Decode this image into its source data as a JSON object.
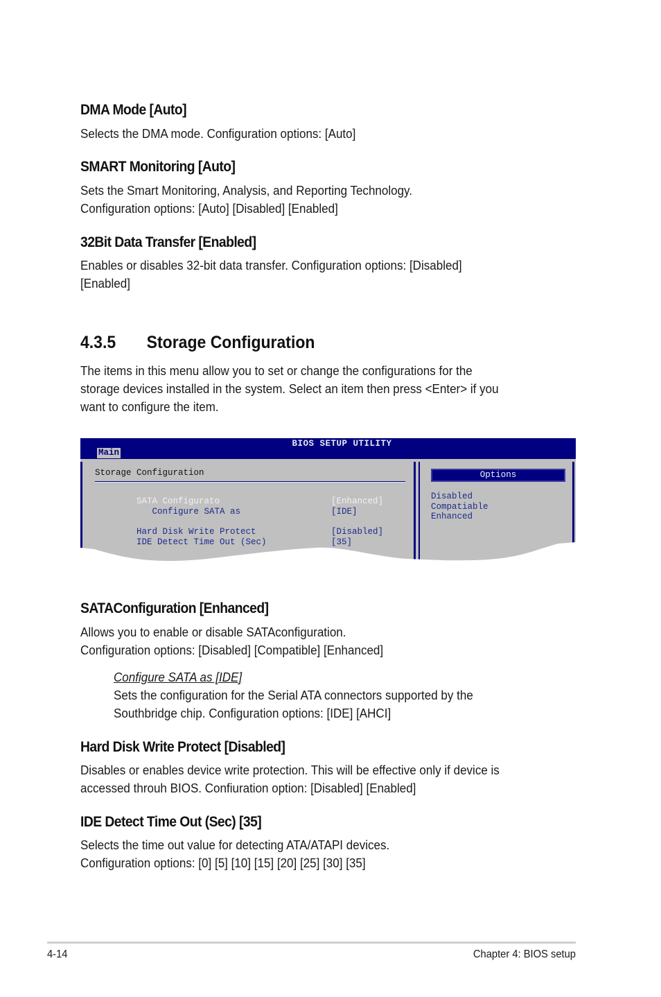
{
  "sections": [
    {
      "heading": "DMA Mode [Auto]",
      "lines": [
        "Selects the DMA mode. Configuration options: [Auto]"
      ]
    },
    {
      "heading": "SMART Monitoring [Auto]",
      "lines": [
        "Sets the Smart Monitoring, Analysis, and Reporting Technology.",
        "Configuration options: [Auto] [Disabled] [Enabled]"
      ]
    },
    {
      "heading": "32Bit Data Transfer [Enabled]",
      "lines": [
        "Enables or disables 32-bit data transfer. Configuration options: [Disabled]",
        "[Enabled]"
      ]
    }
  ],
  "chapter_section": {
    "number": "4.3.5",
    "title": "Storage Configuration",
    "intro_lines": [
      "The items in this menu allow you to set or change the configurations for the",
      "storage devices installed in the system. Select an item then press <Enter> if you",
      "want to configure the item."
    ]
  },
  "bios": {
    "title": "BIOS SETUP UTILITY",
    "active_tab": "Main",
    "section_title": "Storage Configuration",
    "items": [
      {
        "label": "SATA Configurato",
        "value": "[Enhanced]",
        "highlighted": true
      },
      {
        "label": "   Configure SATA as",
        "value": "[IDE]",
        "highlighted": false
      },
      {
        "label": "Hard Disk Write Protect",
        "value": "[Disabled]",
        "highlighted": false
      },
      {
        "label": "IDE Detect Time Out (Sec)",
        "value": "[35]",
        "highlighted": false
      }
    ],
    "options_header": "Options",
    "options": [
      "Disabled",
      "Compatiable",
      "Enhanced"
    ],
    "colors": {
      "header_bg": "#000080",
      "panel_bg": "#c0c0c0",
      "item_text": "#1d2a8c",
      "highlight_text": "#f2f2f2"
    }
  },
  "sections_after": [
    {
      "heading": "SATAConfiguration [Enhanced]",
      "lines": [
        "Allows you to enable or disable SATAconfiguration.",
        "Configuration options: [Disabled] [Compatible] [Enhanced]"
      ],
      "sub": {
        "title": "Configure SATA as [IDE]",
        "lines": [
          "Sets the configuration for the Serial ATA connectors supported by the",
          "Southbridge chip. Configuration options: [IDE] [AHCI]"
        ]
      }
    },
    {
      "heading": "Hard Disk Write Protect [Disabled]",
      "lines": [
        "Disables or enables device write protection. This will be effective only if device is",
        "accessed throuh BIOS. Confiuration option: [Disabled] [Enabled]"
      ]
    },
    {
      "heading": "IDE Detect Time Out (Sec) [35]",
      "lines": [
        "Selects the time out value for detecting ATA/ATAPI devices.",
        "Configuration options: [0] [5] [10] [15] [20] [25] [30] [35]"
      ]
    }
  ],
  "footer": {
    "page_number": "4-14",
    "chapter": "Chapter 4: BIOS setup"
  }
}
